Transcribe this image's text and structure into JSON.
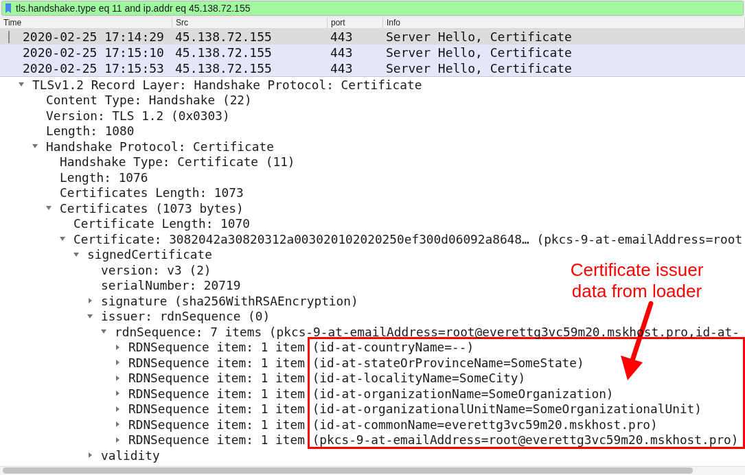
{
  "filter": {
    "value": "tls.handshake.type eq 11 and ip.addr eq 45.138.72.155"
  },
  "packet_list": {
    "columns": [
      "Time",
      "Src",
      "port",
      "Info"
    ],
    "rows": [
      {
        "time": "2020-02-25 17:14:29",
        "src": "45.138.72.155",
        "port": "443",
        "info": "Server Hello, Certificate",
        "selected": true
      },
      {
        "time": "2020-02-25 17:15:10",
        "src": "45.138.72.155",
        "port": "443",
        "info": "Server Hello, Certificate",
        "selected": false
      },
      {
        "time": "2020-02-25 17:15:53",
        "src": "45.138.72.155",
        "port": "443",
        "info": "Server Hello, Certificate",
        "selected": false
      }
    ]
  },
  "details": {
    "tree": [
      {
        "text": "TLSv1.2 Record Layer: Handshake Protocol: Certificate",
        "expanded": true,
        "children": [
          {
            "text": "Content Type: Handshake (22)"
          },
          {
            "text": "Version: TLS 1.2 (0x0303)"
          },
          {
            "text": "Length: 1080"
          },
          {
            "text": "Handshake Protocol: Certificate",
            "expanded": true,
            "children": [
              {
                "text": "Handshake Type: Certificate (11)"
              },
              {
                "text": "Length: 1076"
              },
              {
                "text": "Certificates Length: 1073"
              },
              {
                "text": "Certificates (1073 bytes)",
                "expanded": true,
                "children": [
                  {
                    "text": "Certificate Length: 1070"
                  },
                  {
                    "text": "Certificate: 3082042a30820312a003020102020250ef300d06092a8648… (pkcs-9-at-emailAddress=root",
                    "expanded": true,
                    "children": [
                      {
                        "text": "signedCertificate",
                        "expanded": true,
                        "children": [
                          {
                            "text": "version: v3 (2)"
                          },
                          {
                            "text": "serialNumber: 20719"
                          },
                          {
                            "text": "signature (sha256WithRSAEncryption)",
                            "expanded": false
                          },
                          {
                            "text": "issuer: rdnSequence (0)",
                            "expanded": true,
                            "children": [
                              {
                                "text": "rdnSequence: 7 items (pkcs-9-at-emailAddress=root@everettg3vc59m20.mskhost.pro,id-at-",
                                "expanded": true,
                                "children": [
                                  {
                                    "text": "RDNSequence item: 1 item (id-at-countryName=--)",
                                    "expanded": false
                                  },
                                  {
                                    "text": "RDNSequence item: 1 item (id-at-stateOrProvinceName=SomeState)",
                                    "expanded": false
                                  },
                                  {
                                    "text": "RDNSequence item: 1 item (id-at-localityName=SomeCity)",
                                    "expanded": false
                                  },
                                  {
                                    "text": "RDNSequence item: 1 item (id-at-organizationName=SomeOrganization)",
                                    "expanded": false
                                  },
                                  {
                                    "text": "RDNSequence item: 1 item (id-at-organizationalUnitName=SomeOrganizationalUnit)",
                                    "expanded": false
                                  },
                                  {
                                    "text": "RDNSequence item: 1 item (id-at-commonName=everettg3vc59m20.mskhost.pro)",
                                    "expanded": false
                                  },
                                  {
                                    "text": "RDNSequence item: 1 item (pkcs-9-at-emailAddress=root@everettg3vc59m20.mskhost.pro)",
                                    "expanded": false
                                  }
                                ]
                              }
                            ]
                          },
                          {
                            "text": "validity",
                            "expanded": false
                          }
                        ]
                      }
                    ]
                  }
                ]
              }
            ]
          }
        ]
      }
    ]
  },
  "annotation": {
    "text": "Certificate issuer data from loader"
  }
}
